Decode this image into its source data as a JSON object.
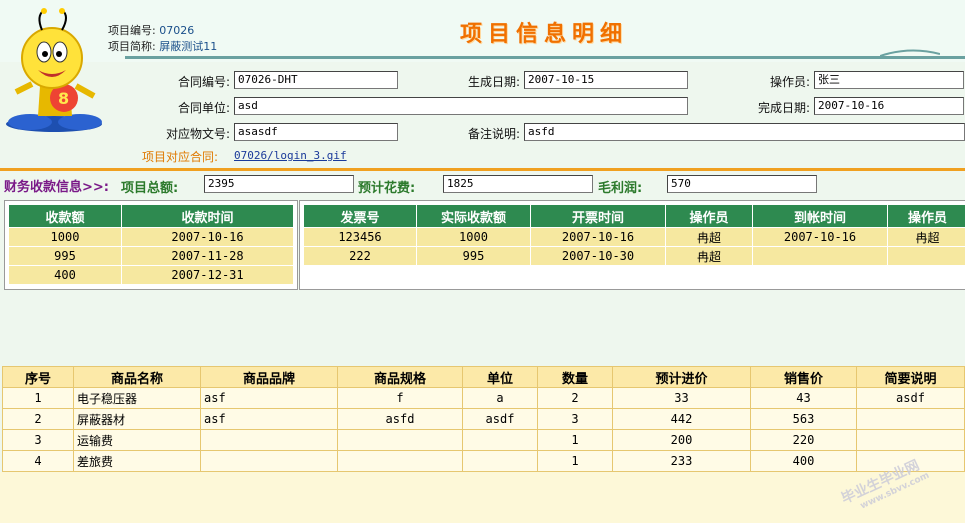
{
  "header": {
    "project_no_label": "项目编号:",
    "project_no": "07026",
    "project_name_label": "项目简称:",
    "project_name": "屏蔽测试11",
    "title": "项目信息明细"
  },
  "form": {
    "contract_no_label": "合同编号:",
    "contract_no": "07026-DHT",
    "gen_date_label": "生成日期:",
    "gen_date": "2007-10-15",
    "operator_label": "操作员:",
    "operator": "张三",
    "contract_unit_label": "合同单位:",
    "contract_unit": "asd",
    "finish_date_label": "完成日期:",
    "finish_date": "2007-10-16",
    "doc_no_label": "对应物文号:",
    "doc_no": "asasdf",
    "remark_label": "备注说明:",
    "remark": "asfd",
    "contract_file_label": "项目对应合同:",
    "contract_file_link": "07026/login_3.gif"
  },
  "finance": {
    "section_label": "财务收款信息>>:",
    "total_label": "项目总额:",
    "total": "2395",
    "est_cost_label": "预计花费:",
    "est_cost": "1825",
    "profit_label": "毛利润:",
    "profit": "570"
  },
  "receipts": {
    "headers": [
      "收款额",
      "收款时间"
    ],
    "rows": [
      [
        "1000",
        "2007-10-16"
      ],
      [
        "995",
        "2007-11-28"
      ],
      [
        "400",
        "2007-12-31"
      ]
    ]
  },
  "invoices": {
    "headers": [
      "发票号",
      "实际收款额",
      "开票时间",
      "操作员",
      "到帐时间",
      "操作员"
    ],
    "rows": [
      [
        "123456",
        "1000",
        "2007-10-16",
        "冉超",
        "2007-10-16",
        "冉超"
      ],
      [
        "222",
        "995",
        "2007-10-30",
        "冉超",
        "",
        ""
      ]
    ]
  },
  "goods": {
    "headers": [
      "序号",
      "商品名称",
      "商品品牌",
      "商品规格",
      "单位",
      "数量",
      "预计进价",
      "销售价",
      "简要说明"
    ],
    "rows": [
      [
        "1",
        "电子稳压器",
        "asf",
        "f",
        "a",
        "2",
        "33",
        "43",
        "asdf"
      ],
      [
        "2",
        "屏蔽器材",
        "asf",
        "asfd",
        "asdf",
        "3",
        "442",
        "563",
        ""
      ],
      [
        "3",
        "运输费",
        "",
        "",
        "",
        "1",
        "200",
        "220",
        ""
      ],
      [
        "4",
        "差旅费",
        "",
        "",
        "",
        "1",
        "233",
        "400",
        ""
      ]
    ]
  },
  "watermark": {
    "text": "毕业生毕业网",
    "sub": "www.sbvv.com"
  },
  "colors": {
    "title": "#f07000",
    "table_header_green": "#2e8a50",
    "row_yellow": "#f6e8a0",
    "finance_purple": "#7a1a88",
    "finance_green": "#2c7a2c"
  },
  "icons": {
    "mascot": "bee-mascot-icon"
  }
}
